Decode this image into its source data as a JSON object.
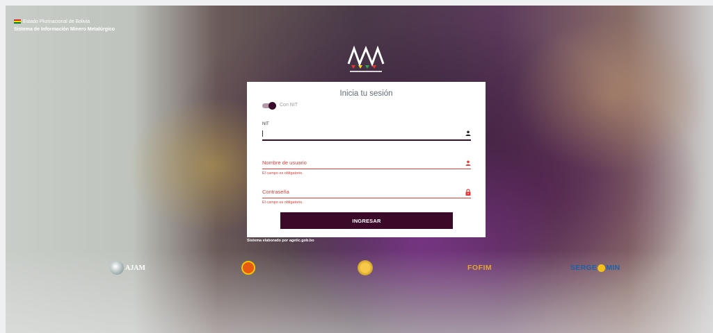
{
  "header": {
    "country": "Estado Plurinacional de Bolivia",
    "system": "Sistema de Información Minero Metalúrgico"
  },
  "login": {
    "title": "Inicia tu sesión",
    "toggle_label": "Con NIT",
    "toggle_on": true,
    "nit_label": "NIT",
    "nit_value": "",
    "username_placeholder": "Nombre de usuario",
    "username_error": "El campo es obligatorio.",
    "password_placeholder": "Contraseña",
    "password_error": "El campo es obligatorio.",
    "submit_label": "INGRESAR"
  },
  "footer": {
    "credit": "Sistema elaborado por agetic.gob.bo"
  },
  "partners": {
    "ajam": "AJAM",
    "fofim": "FOFIM",
    "sergeo_a": "SERGE",
    "sergeo_b": "MIN"
  },
  "colors": {
    "primary": "#3a0a28",
    "error": "#e53935",
    "text_muted": "#9a9a9a"
  }
}
